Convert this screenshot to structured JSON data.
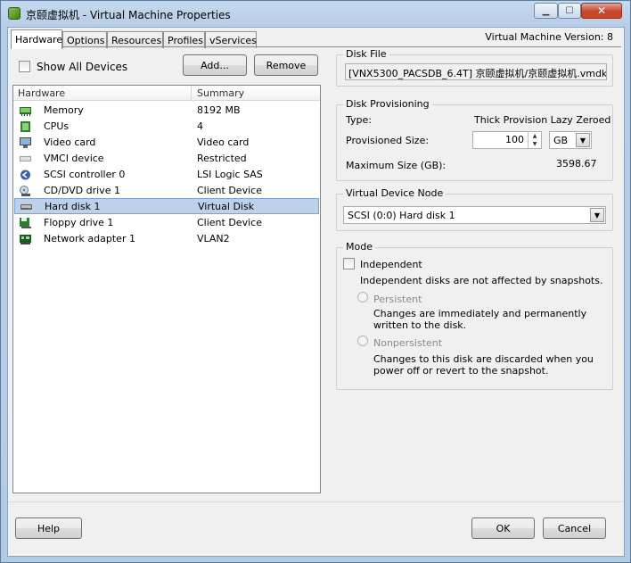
{
  "window": {
    "title": "京颐虚拟机 - Virtual Machine Properties",
    "controls": {
      "minimize": "▁",
      "maximize": "☐",
      "close": "✕"
    }
  },
  "tabs": [
    {
      "label": "Hardware",
      "active": true
    },
    {
      "label": "Options"
    },
    {
      "label": "Resources"
    },
    {
      "label": "Profiles"
    },
    {
      "label": "vServices"
    }
  ],
  "vm_version": "Virtual Machine Version: 8",
  "hardware_panel": {
    "show_all_devices": "Show All Devices",
    "add_button": "Add...",
    "remove_button": "Remove",
    "columns": {
      "hardware": "Hardware",
      "summary": "Summary"
    },
    "rows": [
      {
        "name": "Memory",
        "summary": "8192 MB",
        "icon": "memory-icon"
      },
      {
        "name": "CPUs",
        "summary": "4",
        "icon": "cpu-icon"
      },
      {
        "name": "Video card",
        "summary": "Video card",
        "icon": "video-card-icon"
      },
      {
        "name": "VMCI device",
        "summary": "Restricted",
        "icon": "vmci-device-icon"
      },
      {
        "name": "SCSI controller 0",
        "summary": "LSI Logic SAS",
        "icon": "scsi-controller-icon"
      },
      {
        "name": "CD/DVD drive 1",
        "summary": "Client Device",
        "icon": "cd-dvd-icon"
      },
      {
        "name": "Hard disk 1",
        "summary": "Virtual Disk",
        "icon": "hard-disk-icon",
        "selected": true
      },
      {
        "name": "Floppy drive 1",
        "summary": "Client Device",
        "icon": "floppy-icon"
      },
      {
        "name": "Network adapter 1",
        "summary": "VLAN2",
        "icon": "network-adapter-icon"
      }
    ]
  },
  "disk_file": {
    "title": "Disk File",
    "value": "[VNX5300_PACSDB_6.4T] 京颐虚拟机/京颐虚拟机.vmdk"
  },
  "disk_provisioning": {
    "title": "Disk Provisioning",
    "type_label": "Type:",
    "type_value": "Thick Provision Lazy Zeroed",
    "size_label": "Provisioned Size:",
    "size_value": "100",
    "unit_value": "GB",
    "max_label": "Maximum Size (GB):",
    "max_value": "3598.67"
  },
  "virtual_device_node": {
    "title": "Virtual Device Node",
    "value": "SCSI (0:0) Hard disk 1"
  },
  "mode": {
    "title": "Mode",
    "independent_label": "Independent",
    "independent_desc": "Independent disks are not affected by snapshots.",
    "persistent_label": "Persistent",
    "persistent_desc": "Changes are immediately and permanently written to the disk.",
    "nonpersistent_label": "Nonpersistent",
    "nonpersistent_desc": "Changes to this disk are discarded when you power off or revert to the snapshot."
  },
  "footer": {
    "help": "Help",
    "ok": "OK",
    "cancel": "Cancel"
  },
  "colors": {
    "selection": "#bdd2ea",
    "close_button": "#c8452a",
    "window_frame": "#b7cde6"
  }
}
